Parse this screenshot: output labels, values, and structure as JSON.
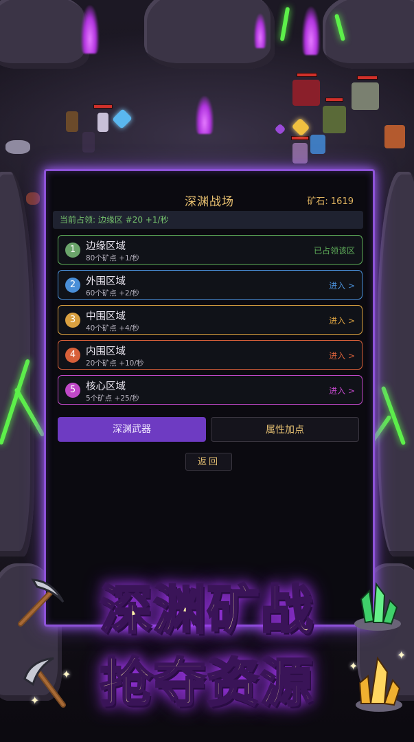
{
  "panel": {
    "title": "深渊战场",
    "ore_label": "矿石: 1619",
    "occupied": "当前占领: 边缘区 #20  +1/秒"
  },
  "zones": [
    {
      "num": "1",
      "name": "边缘区域",
      "info": "80个矿点  +1/秒",
      "action": "已占领该区",
      "color": "#5fae5a",
      "badge": "#6aa46a"
    },
    {
      "num": "2",
      "name": "外围区域",
      "info": "60个矿点  +2/秒",
      "action": "进入 >",
      "color": "#4a8fd8",
      "badge": "#4a8fd8"
    },
    {
      "num": "3",
      "name": "中围区域",
      "info": "40个矿点  +4/秒",
      "action": "进入 >",
      "color": "#d9a040",
      "badge": "#d9a040"
    },
    {
      "num": "4",
      "name": "内围区域",
      "info": "20个矿点  +10/秒",
      "action": "进入 >",
      "color": "#d8603a",
      "badge": "#d8603a"
    },
    {
      "num": "5",
      "name": "核心区域",
      "info": "5个矿点  +25/秒",
      "action": "进入 >",
      "color": "#c048c8",
      "badge": "#c048c8"
    }
  ],
  "buttons": {
    "weapon": "深渊武器",
    "attributes": "属性加点",
    "back": "返回"
  },
  "promo": {
    "line1": "深渊矿战",
    "line2": "抢夺资源"
  }
}
